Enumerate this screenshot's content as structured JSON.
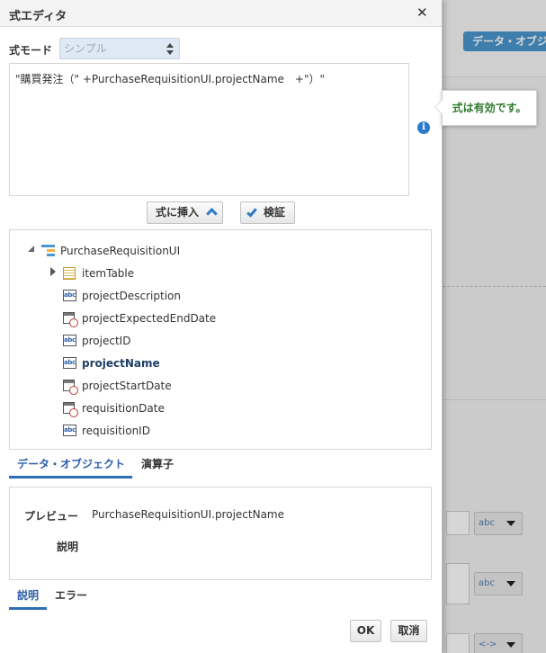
{
  "background": {
    "top_button": "データ・オブジ",
    "selects": [
      "abc",
      "abc",
      "<->"
    ]
  },
  "dialog": {
    "title": "式エディタ",
    "close_icon": "close-icon",
    "mode_label": "式モード",
    "mode_value": "シンプル",
    "expression": "\"購買発注（\" +PurchaseRequisitionUI.projectName　+\"）\"",
    "validation_message": "式は有効です。",
    "info_icon_glyph": "i",
    "insert_button": "式に挿入",
    "verify_button": "検証",
    "tree": {
      "root": "PurchaseRequisitionUI",
      "items": [
        {
          "label": "itemTable",
          "icon": "table-icon"
        },
        {
          "label": "projectDescription",
          "icon": "abc-icon"
        },
        {
          "label": "projectExpectedEndDate",
          "icon": "date-icon"
        },
        {
          "label": "projectID",
          "icon": "abc-icon"
        },
        {
          "label": "projectName",
          "icon": "abc-icon",
          "selected": true
        },
        {
          "label": "projectStartDate",
          "icon": "date-icon"
        },
        {
          "label": "requisitionDate",
          "icon": "date-icon"
        },
        {
          "label": "requisitionID",
          "icon": "abc-icon"
        }
      ]
    },
    "tabs_top": [
      "データ・オブジェクト",
      "演算子"
    ],
    "preview_label": "プレビュー",
    "preview_value": "PurchaseRequisitionUI.projectName",
    "description_label": "説明",
    "tabs_bottom": [
      "説明",
      "エラー"
    ],
    "ok_button": "OK",
    "cancel_button": "取消",
    "colors": {
      "accent": "#2d6eb4",
      "valid": "#2d7a2d",
      "info": "#2d7ac9"
    }
  }
}
